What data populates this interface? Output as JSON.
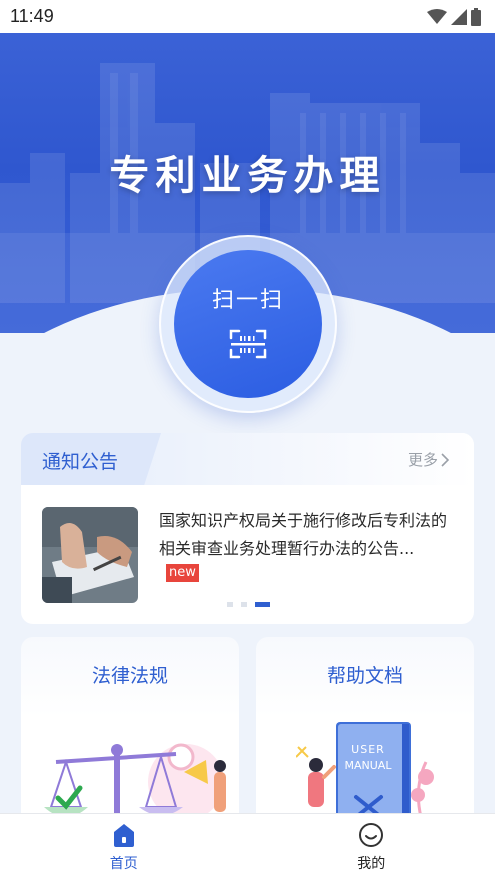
{
  "status_bar": {
    "time": "11:49",
    "icons": [
      "wifi-icon",
      "signal-icon",
      "battery-icon"
    ]
  },
  "hero": {
    "title": "专利业务办理"
  },
  "scan": {
    "label": "扫一扫",
    "icon": "scan-icon"
  },
  "notice": {
    "title": "通知公告",
    "more_label": "更多",
    "item_text": "国家知识产权局关于施行修改后专利法的相关审查业务处理暂行办法的公告...",
    "badge": "new",
    "carousel_pages": 3,
    "carousel_active": 3
  },
  "features": {
    "law": {
      "title": "法律法规",
      "illustration": "scales-illustration"
    },
    "help": {
      "title": "帮助文档",
      "illustration": "user-manual-illustration",
      "book_text_1": "USER",
      "book_text_2": "MANUAL"
    }
  },
  "bottom_nav": {
    "home_label": "首页",
    "me_label": "我的"
  },
  "colors": {
    "accent": "#2f5fd0",
    "badge": "#e8453c",
    "hero": "#3b62d6"
  }
}
